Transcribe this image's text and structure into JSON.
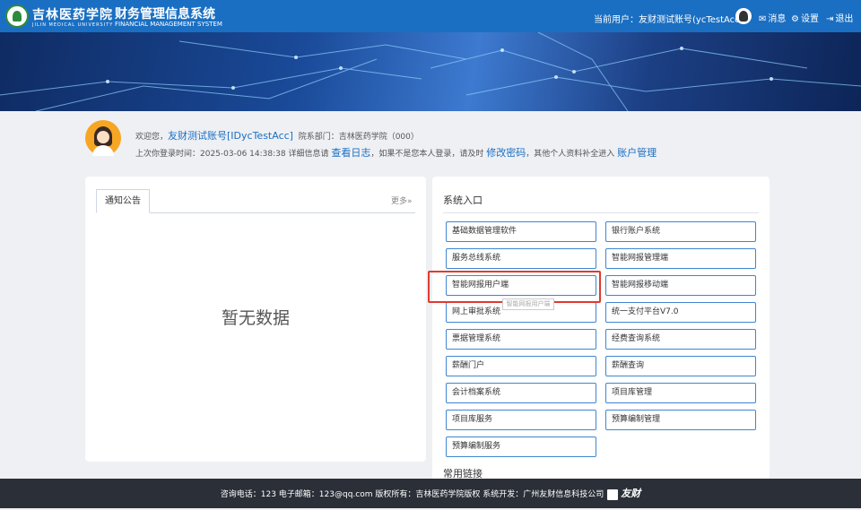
{
  "header": {
    "school_cn": "吉林医药学院",
    "school_en": "JILIN MEDICAL UNIVERSITY",
    "system_cn": "财务管理信息系统",
    "system_en": "FINANCIAL MANAGEMENT SYSTEM",
    "current_user": "当前用户：友财测试账号(ycTestAcc)",
    "nav": {
      "messages": "消息",
      "settings": "设置",
      "logout": "退出"
    }
  },
  "welcome": {
    "greeting": "欢迎您，",
    "user_name": "友财测试账号[IDycTestAcc]",
    "dept": "院系部门：吉林医药学院（000）",
    "last_login_prefix": "上次你登录时间：2025-03-06 14:38:38 详细信息请",
    "view_log": "查看日志",
    "middle": "，如果不是您本人登录，请及时",
    "change_pwd": "修改密码",
    "suffix": "，其他个人资料补全进入",
    "account_mgmt": "账户管理"
  },
  "notice": {
    "tab_label": "通知公告",
    "more_label": "更多»",
    "empty_text": "暂无数据"
  },
  "entry": {
    "title": "系统入口",
    "systems": [
      "基础数据管理软件",
      "银行账户系统",
      "服务总线系统",
      "智能网报管理端",
      "智能网报用户端",
      "智能网报移动端",
      "网上审批系统",
      "统一支付平台V7.0",
      "票据管理系统",
      "经费查询系统",
      "薪酬门户",
      "薪酬查询",
      "会计档案系统",
      "项目库管理",
      "项目库服务",
      "预算编制管理",
      "预算编制服务"
    ],
    "common_links": "常用链接",
    "tooltip": "智能网报用户端"
  },
  "footer": {
    "text": "咨询电话：123  电子邮箱：123@qq.com  版权所有：吉林医药学院版权  系统开发：广州友财信息科技公司",
    "brand": "友财"
  },
  "colors": {
    "topbar": "#1a6fc2",
    "accent": "#1a6fc2",
    "highlight": "#e03a2f",
    "footer": "#2a2f38"
  }
}
